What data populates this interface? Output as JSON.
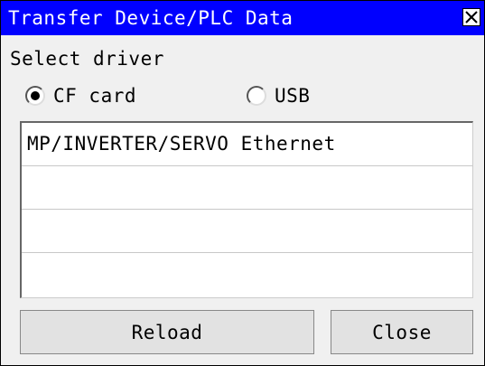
{
  "dialog": {
    "title": "Transfer Device/PLC Data",
    "close_icon": "close-x-icon"
  },
  "driver": {
    "label": "Select driver",
    "options": [
      {
        "label": "CF card",
        "selected": true
      },
      {
        "label": "USB",
        "selected": false
      }
    ]
  },
  "list": {
    "rows": [
      "MP/INVERTER/SERVO Ethernet",
      "",
      "",
      ""
    ]
  },
  "buttons": {
    "reload": "Reload",
    "close": "Close"
  },
  "colors": {
    "titlebar": "#0000ff",
    "title_text": "#ffffff",
    "background": "#f0f0f0"
  }
}
